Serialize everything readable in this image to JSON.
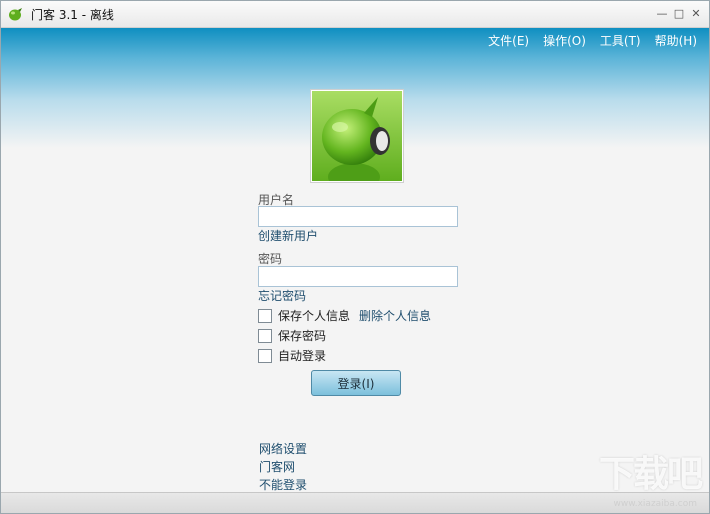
{
  "window": {
    "title": "门客 3.1 - 离线",
    "controls": [
      "—",
      "□",
      "✕"
    ]
  },
  "menu": {
    "file": "文件(E)",
    "operate": "操作(O)",
    "tools": "工具(T)",
    "help": "帮助(H)"
  },
  "login": {
    "username_label": "用户名",
    "username_value": "",
    "create_user": "创建新用户",
    "password_label": "密码",
    "password_value": "",
    "forgot_password": "忘记密码",
    "save_profile": "保存个人信息",
    "delete_profile": "删除个人信息",
    "save_password": "保存密码",
    "auto_login": "自动登录",
    "login_button": "登录(I)"
  },
  "links": {
    "network_settings": "网络设置",
    "menke_site": "门客网",
    "cannot_login": "不能登录"
  },
  "watermark": {
    "logo": "下载吧",
    "url": "www.xiazaiba.com"
  }
}
